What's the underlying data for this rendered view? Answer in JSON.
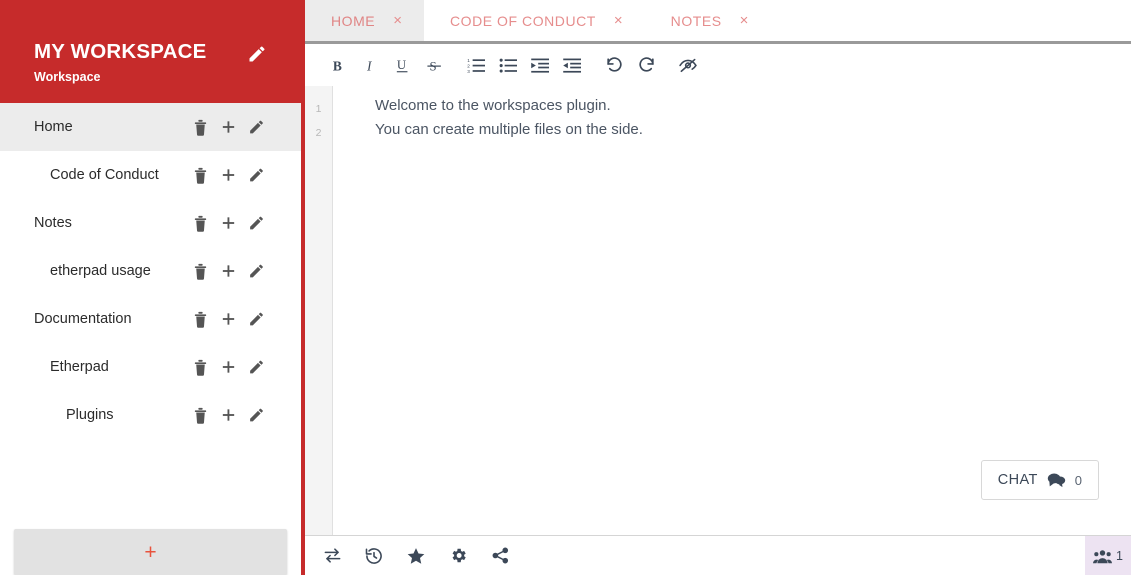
{
  "workspace": {
    "title": "MY WORKSPACE",
    "subtitle": "Workspace",
    "edit_icon": "pencil-icon",
    "accent_color": "#c62b2b"
  },
  "sidebar": {
    "files": [
      {
        "label": "Home",
        "indent": 0,
        "active": true
      },
      {
        "label": "Code of Conduct",
        "indent": 1,
        "active": false
      },
      {
        "label": "Notes",
        "indent": 0,
        "active": false
      },
      {
        "label": "etherpad usage",
        "indent": 1,
        "active": false
      },
      {
        "label": "Documentation",
        "indent": 0,
        "active": false
      },
      {
        "label": "Etherpad",
        "indent": 1,
        "active": false
      },
      {
        "label": "Plugins",
        "indent": 2,
        "active": false
      }
    ],
    "row_icons": [
      "trash-icon",
      "plus-icon",
      "pencil-icon"
    ],
    "add_button": {
      "label": "+",
      "icon": "plus-icon",
      "color": "#e8533d"
    }
  },
  "tabs": [
    {
      "label": "HOME",
      "active": true,
      "close": "×"
    },
    {
      "label": "CODE OF CONDUCT",
      "active": false,
      "close": "×"
    },
    {
      "label": "NOTES",
      "active": false,
      "close": "×"
    }
  ],
  "toolbar": {
    "buttons": [
      {
        "name": "bold-icon",
        "label": "B"
      },
      {
        "name": "italic-icon",
        "label": "I"
      },
      {
        "name": "underline-icon",
        "label": "U"
      },
      {
        "name": "strikethrough-icon",
        "label": "S"
      },
      {
        "name": "ordered-list-icon",
        "label": ""
      },
      {
        "name": "unordered-list-icon",
        "label": ""
      },
      {
        "name": "indent-icon",
        "label": ""
      },
      {
        "name": "outdent-icon",
        "label": ""
      },
      {
        "name": "undo-icon",
        "label": ""
      },
      {
        "name": "redo-icon",
        "label": ""
      },
      {
        "name": "clear-authorship-icon",
        "label": ""
      }
    ]
  },
  "editor": {
    "line_numbers": [
      "1",
      "2"
    ],
    "lines": [
      "Welcome to the workspaces plugin.",
      "You can create multiple files on the side."
    ]
  },
  "chat": {
    "label": "CHAT",
    "icon": "chat-bubble-icon",
    "count": "0"
  },
  "bottombar": {
    "buttons": [
      {
        "name": "import-export-icon"
      },
      {
        "name": "history-icon"
      },
      {
        "name": "star-icon"
      },
      {
        "name": "settings-gear-icon"
      },
      {
        "name": "share-icon"
      }
    ],
    "users": {
      "icon": "users-icon",
      "count": "1",
      "background": "#ede3f2"
    }
  }
}
